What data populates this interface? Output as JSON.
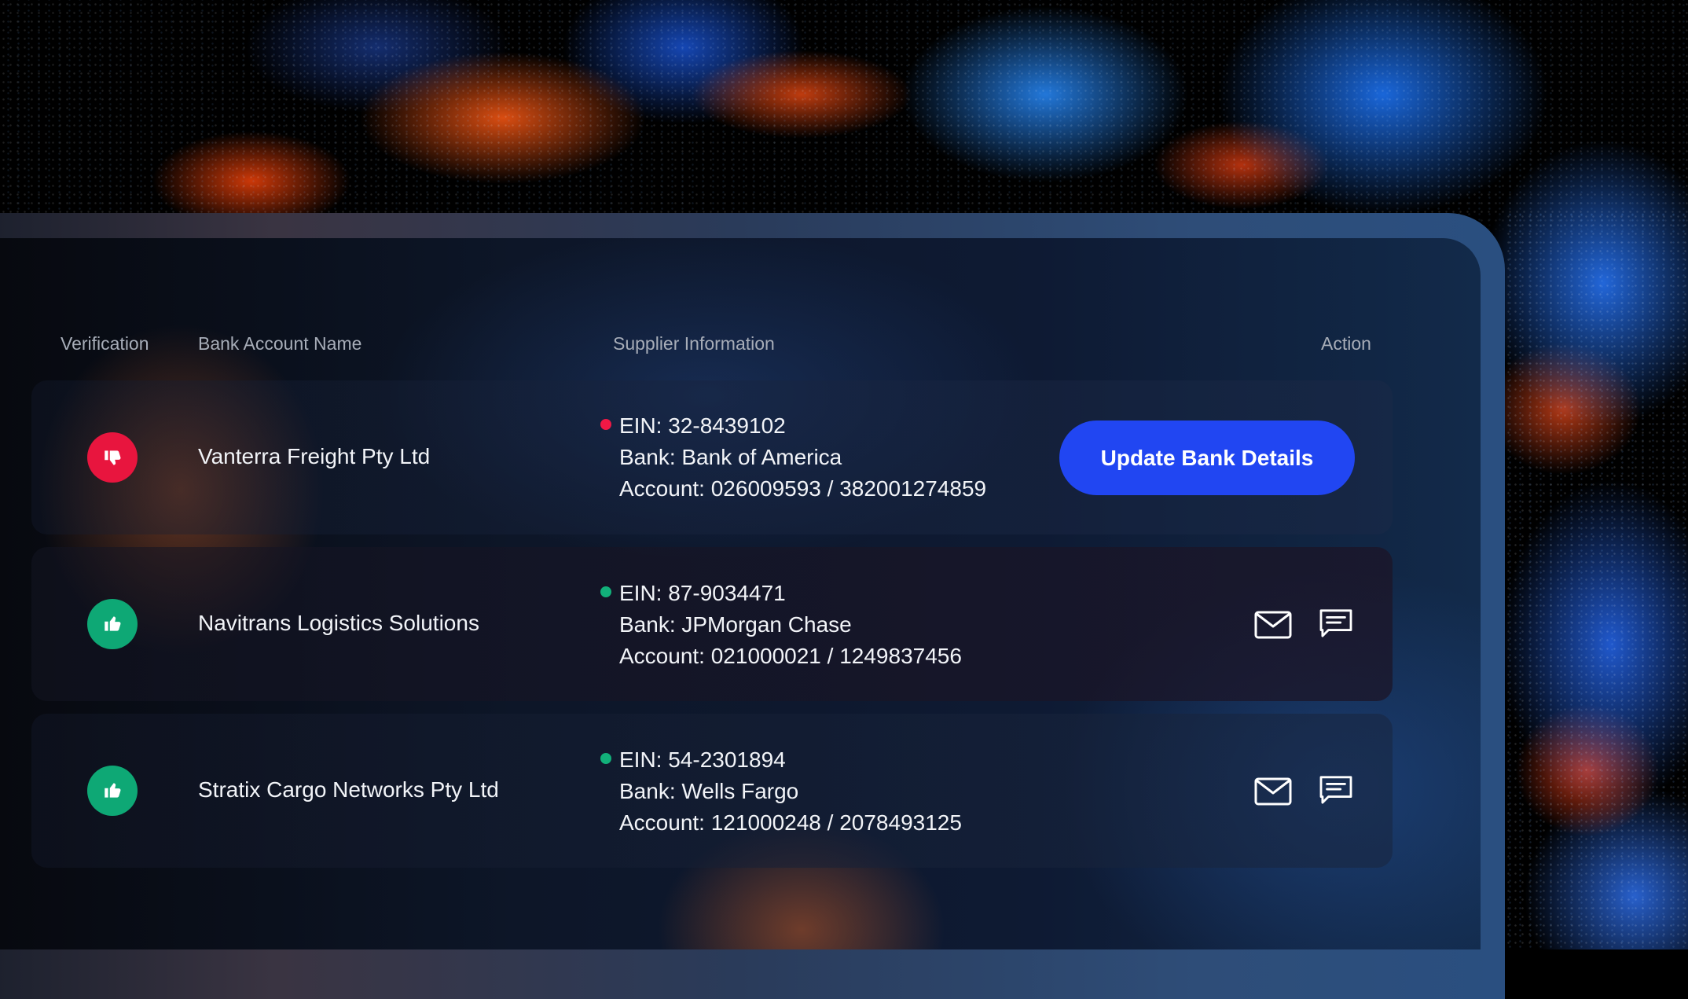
{
  "table": {
    "headers": {
      "verification": "Verification",
      "bank_account_name": "Bank Account Name",
      "supplier_information": "Supplier Information",
      "action": "Action"
    },
    "rows": [
      {
        "verification": "rejected",
        "status_color": "#e8153e",
        "name": "Vanterra Freight Pty Ltd",
        "ein": "EIN: 32-8439102",
        "bank": "Bank: Bank of America",
        "account": "Account: 026009593 / 382001274859",
        "action_label": "Update Bank Details"
      },
      {
        "verification": "verified",
        "status_color": "#0ea875",
        "name": "Navitrans Logistics Solutions",
        "ein": "EIN: 87-9034471",
        "bank": "Bank: JPMorgan Chase",
        "account": "Account: 021000021 / 1249837456",
        "actions": [
          "mail-icon",
          "message-icon"
        ]
      },
      {
        "verification": "verified",
        "status_color": "#0ea875",
        "name": "Stratix Cargo Networks Pty Ltd",
        "ein": "EIN: 54-2301894",
        "bank": "Bank: Wells Fargo",
        "account": "Account: 121000248 / 2078493125",
        "actions": [
          "mail-icon",
          "message-icon"
        ]
      }
    ]
  },
  "colors": {
    "accent_button": "#2146f2",
    "rejected": "#e8153e",
    "verified": "#0ea875"
  }
}
